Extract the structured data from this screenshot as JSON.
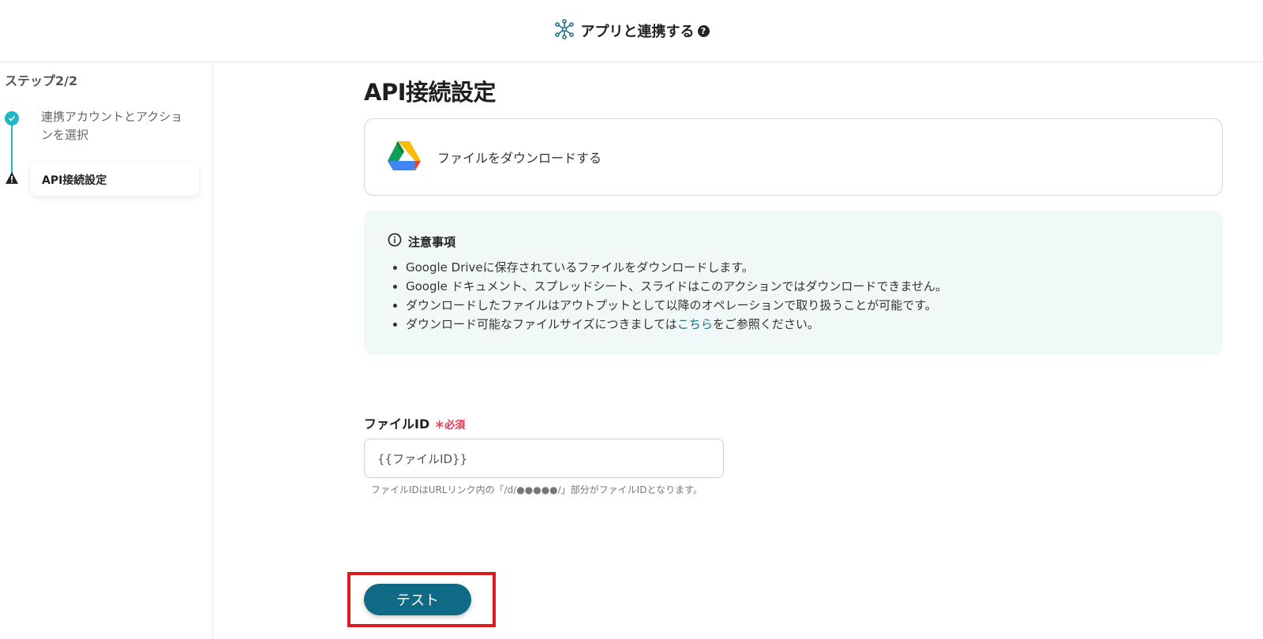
{
  "header": {
    "title": "アプリと連携する",
    "help": "?"
  },
  "sidebar": {
    "step_count": "ステップ2/2",
    "steps": [
      {
        "label": "連携アカウントとアクションを選択",
        "status": "done"
      },
      {
        "label": "API接続設定",
        "status": "current"
      }
    ]
  },
  "main": {
    "title": "API接続設定",
    "action": {
      "label": "ファイルをダウンロードする",
      "icon": "google-drive-icon"
    },
    "notice": {
      "title": "注意事項",
      "items": [
        "Google Driveに保存されているファイルをダウンロードします。",
        "Google ドキュメント、スプレッドシート、スライドはこのアクションではダウンロードできません。",
        "ダウンロードしたファイルはアウトプットとして以降のオペレーションで取り扱うことが可能です。"
      ],
      "last_item": {
        "before": "ダウンロード可能なファイルサイズにつきましては",
        "link": "こちら",
        "after": "をご参照ください。"
      }
    },
    "field": {
      "label": "ファイルID",
      "required_mark": "＊",
      "required_text": "必須",
      "value": "{{ファイルID}}",
      "hint": "ファイルIDはURLリンク内の「/d/●●●●●/」部分がファイルIDとなります。"
    },
    "test_button": "テスト"
  },
  "colors": {
    "accent": "#1fb6c8",
    "button": "#0f6a85",
    "highlight": "#e0191f",
    "required": "#e0344c"
  }
}
